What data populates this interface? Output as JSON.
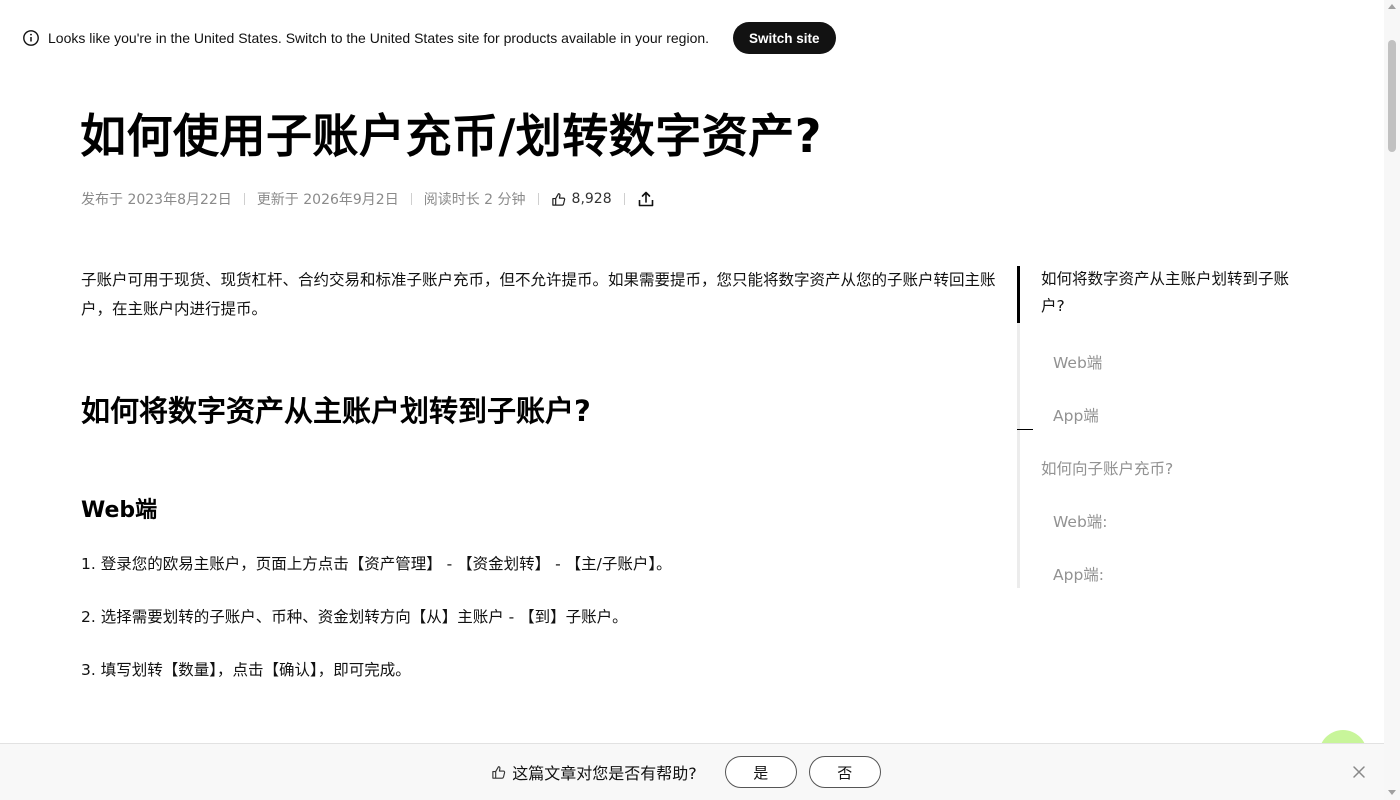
{
  "banner": {
    "message": "Looks like you're in the United States. Switch to the United States site for products available in your region.",
    "switch_label": "Switch site"
  },
  "article": {
    "title": "如何使用子账户充币/划转数字资产?",
    "meta": {
      "published": "发布于 2023年8月22日",
      "updated": "更新于 2026年9月2日",
      "read_time": "阅读时长 2 分钟",
      "likes": "8,928"
    },
    "intro": "子账户可用于现货、现货杠杆、合约交易和标准子账户充币，但不允许提币。如果需要提币，您只能将数字资产从您的子账户转回主账户，在主账户内进行提币。",
    "section_heading": "如何将数字资产从主账户划转到子账户?",
    "subheading": "Web端",
    "steps": [
      "1. 登录您的欧易主账户，页面上方点击【资产管理】 - 【资金划转】 - 【主/子账户】。",
      "2. 选择需要划转的子账户、币种、资金划转方向【从】主账户 - 【到】子账户。",
      "3. 填写划转【数量】，点击【确认】，即可完成。"
    ]
  },
  "toc": {
    "items": [
      "如何将数字资产从主账户划转到子账户?",
      "Web端",
      "App端",
      "如何向子账户充币?",
      "Web端:",
      "App端:"
    ]
  },
  "feedback": {
    "question": "这篇文章对您是否有帮助?",
    "yes_label": "是",
    "no_label": "否"
  }
}
